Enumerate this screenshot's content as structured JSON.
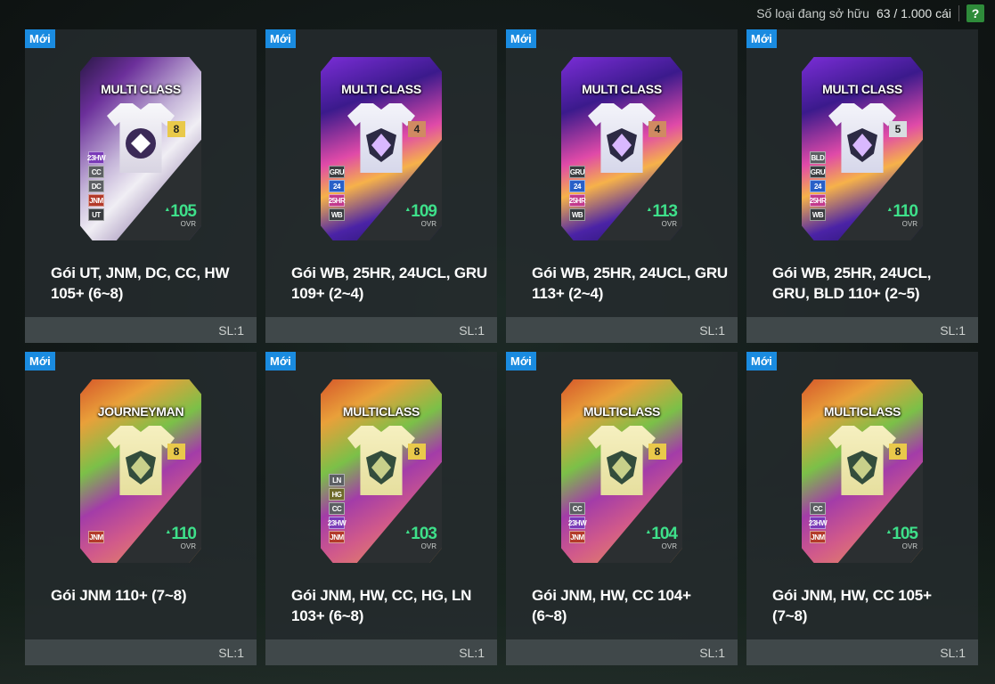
{
  "header": {
    "owned_label": "Số loại đang sở hữu",
    "owned_count": "63 / 1.000 cái",
    "help_label": "?"
  },
  "colors": {
    "new_badge": "#1a8be0",
    "ovr_green": "#3ee08a",
    "help_green": "#2e8b3a"
  },
  "packs": [
    {
      "new_label": "Mới",
      "card_title": "MULTI CLASS",
      "theme": "ut",
      "level": "8",
      "level_color": "gold",
      "badges": [
        "23HW",
        "CC",
        "DC",
        "JNM",
        "UT"
      ],
      "ovr": "105",
      "ovr_label": "OVR",
      "name": "Gói UT, JNM, DC, CC, HW 105+ (6~8)",
      "quantity": "SL:1"
    },
    {
      "new_label": "Mới",
      "card_title": "MULTI CLASS",
      "theme": "mc",
      "level": "4",
      "level_color": "bronze",
      "badges": [
        "GRU",
        "24",
        "25HR",
        "WB"
      ],
      "ovr": "109",
      "ovr_label": "OVR",
      "name": "Gói WB, 25HR, 24UCL, GRU 109+ (2~4)",
      "quantity": "SL:1"
    },
    {
      "new_label": "Mới",
      "card_title": "MULTI CLASS",
      "theme": "mc",
      "level": "4",
      "level_color": "bronze",
      "badges": [
        "GRU",
        "24",
        "25HR",
        "WB"
      ],
      "ovr": "113",
      "ovr_label": "OVR",
      "name": "Gói WB, 25HR, 24UCL, GRU 113+ (2~4)",
      "quantity": "SL:1"
    },
    {
      "new_label": "Mới",
      "card_title": "MULTI CLASS",
      "theme": "mc",
      "level": "5",
      "level_color": "silver",
      "badges": [
        "BLD",
        "GRU",
        "24",
        "25HR",
        "WB"
      ],
      "ovr": "110",
      "ovr_label": "OVR",
      "name": "Gói WB, 25HR, 24UCL, GRU, BLD 110+ (2~5)",
      "quantity": "SL:1"
    },
    {
      "new_label": "Mới",
      "card_title": "JOURNEYMAN",
      "theme": "jn",
      "level": "8",
      "level_color": "gold",
      "badges": [
        "JNM"
      ],
      "ovr": "110",
      "ovr_label": "OVR",
      "name": "Gói JNM 110+ (7~8)",
      "quantity": "SL:1"
    },
    {
      "new_label": "Mới",
      "card_title": "MULTICLASS",
      "theme": "jn",
      "level": "8",
      "level_color": "gold",
      "badges": [
        "LN",
        "HG",
        "CC",
        "23HW",
        "JNM"
      ],
      "ovr": "103",
      "ovr_label": "OVR",
      "name": "Gói JNM, HW, CC, HG, LN 103+ (6~8)",
      "quantity": "SL:1"
    },
    {
      "new_label": "Mới",
      "card_title": "MULTICLASS",
      "theme": "jn",
      "level": "8",
      "level_color": "gold",
      "badges": [
        "CC",
        "23HW",
        "JNM"
      ],
      "ovr": "104",
      "ovr_label": "OVR",
      "name": "Gói JNM, HW, CC 104+ (6~8)",
      "quantity": "SL:1"
    },
    {
      "new_label": "Mới",
      "card_title": "MULTICLASS",
      "theme": "jn",
      "level": "8",
      "level_color": "gold",
      "badges": [
        "CC",
        "23HW",
        "JNM"
      ],
      "ovr": "105",
      "ovr_label": "OVR",
      "name": "Gói JNM, HW, CC 105+ (7~8)",
      "quantity": "SL:1"
    }
  ]
}
